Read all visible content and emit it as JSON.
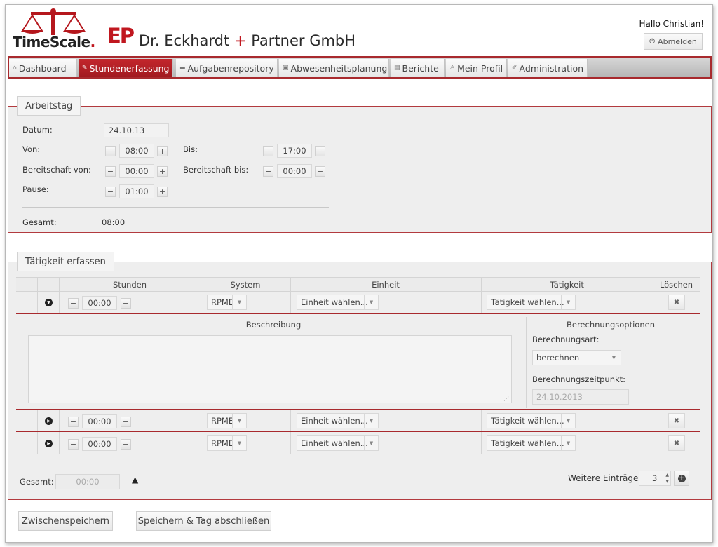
{
  "header": {
    "logo_text": "TimeScale",
    "logo_dot": ".",
    "ep_logo": "EP",
    "company_name": "Dr. Eckhardt",
    "company_plus": "+",
    "company_suffix": "Partner GmbH",
    "greeting": "Hallo Christian!",
    "logout_label": "Abmelden"
  },
  "nav": {
    "items": [
      {
        "label": "Dashboard",
        "icon": "home-icon"
      },
      {
        "label": "Stundenerfassung",
        "icon": "pencil-icon",
        "active": true
      },
      {
        "label": "Aufgabenrepository",
        "icon": "folder-icon"
      },
      {
        "label": "Abwesenheitsplanung",
        "icon": "lock-icon"
      },
      {
        "label": "Berichte",
        "icon": "report-icon"
      },
      {
        "label": "Mein Profil",
        "icon": "user-icon"
      },
      {
        "label": "Administration",
        "icon": "wrench-icon"
      }
    ]
  },
  "arbeitstag": {
    "legend": "Arbeitstag",
    "datum_label": "Datum:",
    "datum_value": "24.10.13",
    "von_label": "Von:",
    "von_value": "08:00",
    "bis_label": "Bis:",
    "bis_value": "17:00",
    "bereitschaft_von_label": "Bereitschaft von:",
    "bereitschaft_von_value": "00:00",
    "bereitschaft_bis_label": "Bereitschaft bis:",
    "bereitschaft_bis_value": "00:00",
    "pause_label": "Pause:",
    "pause_value": "01:00",
    "gesamt_label": "Gesamt:",
    "gesamt_value": "08:00"
  },
  "taetigkeit": {
    "legend": "Tätigkeit erfassen",
    "columns": {
      "stunden": "Stunden",
      "system": "System",
      "einheit": "Einheit",
      "taetigkeit": "Tätigkeit",
      "loeschen": "Löschen"
    },
    "rows": [
      {
        "stunden": "00:00",
        "system": "RPME",
        "einheit": "Einheit wählen...",
        "taetigkeit": "Tätigkeit wählen...",
        "expanded": true
      },
      {
        "stunden": "00:00",
        "system": "RPME",
        "einheit": "Einheit wählen...",
        "taetigkeit": "Tätigkeit wählen...",
        "expanded": false
      },
      {
        "stunden": "00:00",
        "system": "RPME",
        "einheit": "Einheit wählen...",
        "taetigkeit": "Tätigkeit wählen...",
        "expanded": false
      }
    ],
    "detail": {
      "beschreibung_header": "Beschreibung",
      "berechnungsoptionen_header": "Berechnungsoptionen",
      "berechnungsart_label": "Berechnungsart:",
      "berechnungsart_value": "berechnen",
      "berechnungszeitpunkt_label": "Berechnungszeitpunkt:",
      "berechnungszeitpunkt_value": "24.10.2013"
    },
    "gesamt_label": "Gesamt:",
    "gesamt_value": "00:00",
    "weitere_label": "Weitere Einträge:",
    "weitere_value": "3"
  },
  "actions": {
    "zwischenspeichern": "Zwischenspeichern",
    "speichern": "Speichern & Tag abschließen"
  },
  "colors": {
    "accent": "#c0171f",
    "border_red": "#a82a2e",
    "panel_bg": "#eeeeee"
  }
}
